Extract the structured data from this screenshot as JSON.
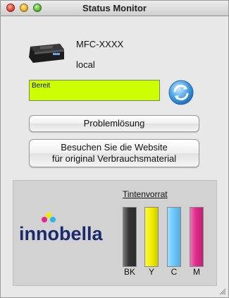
{
  "window": {
    "title": "Status Monitor"
  },
  "device": {
    "model": "MFC-XXXX",
    "connection": "local"
  },
  "status": {
    "text": "Bereit",
    "color": "#ccff00"
  },
  "buttons": {
    "troubleshoot": "Problemlösung",
    "website_line1": "Besuchen Sie die Website",
    "website_line2": "für original Verbrauchsmaterial"
  },
  "ink": {
    "title": "Tintenvorrat",
    "cartridges": [
      {
        "label": "BK",
        "color": "#333333",
        "level": 1.0
      },
      {
        "label": "Y",
        "color": "#f4f000",
        "level": 1.0
      },
      {
        "label": "C",
        "color": "#6cc9ff",
        "level": 1.0
      },
      {
        "label": "M",
        "color": "#e0298a",
        "level": 1.0
      }
    ]
  },
  "brand": {
    "logo_text": "innobella",
    "logo_color": "#1a2a6c"
  },
  "icons": {
    "printer": "printer-icon",
    "refresh": "refresh-icon"
  }
}
